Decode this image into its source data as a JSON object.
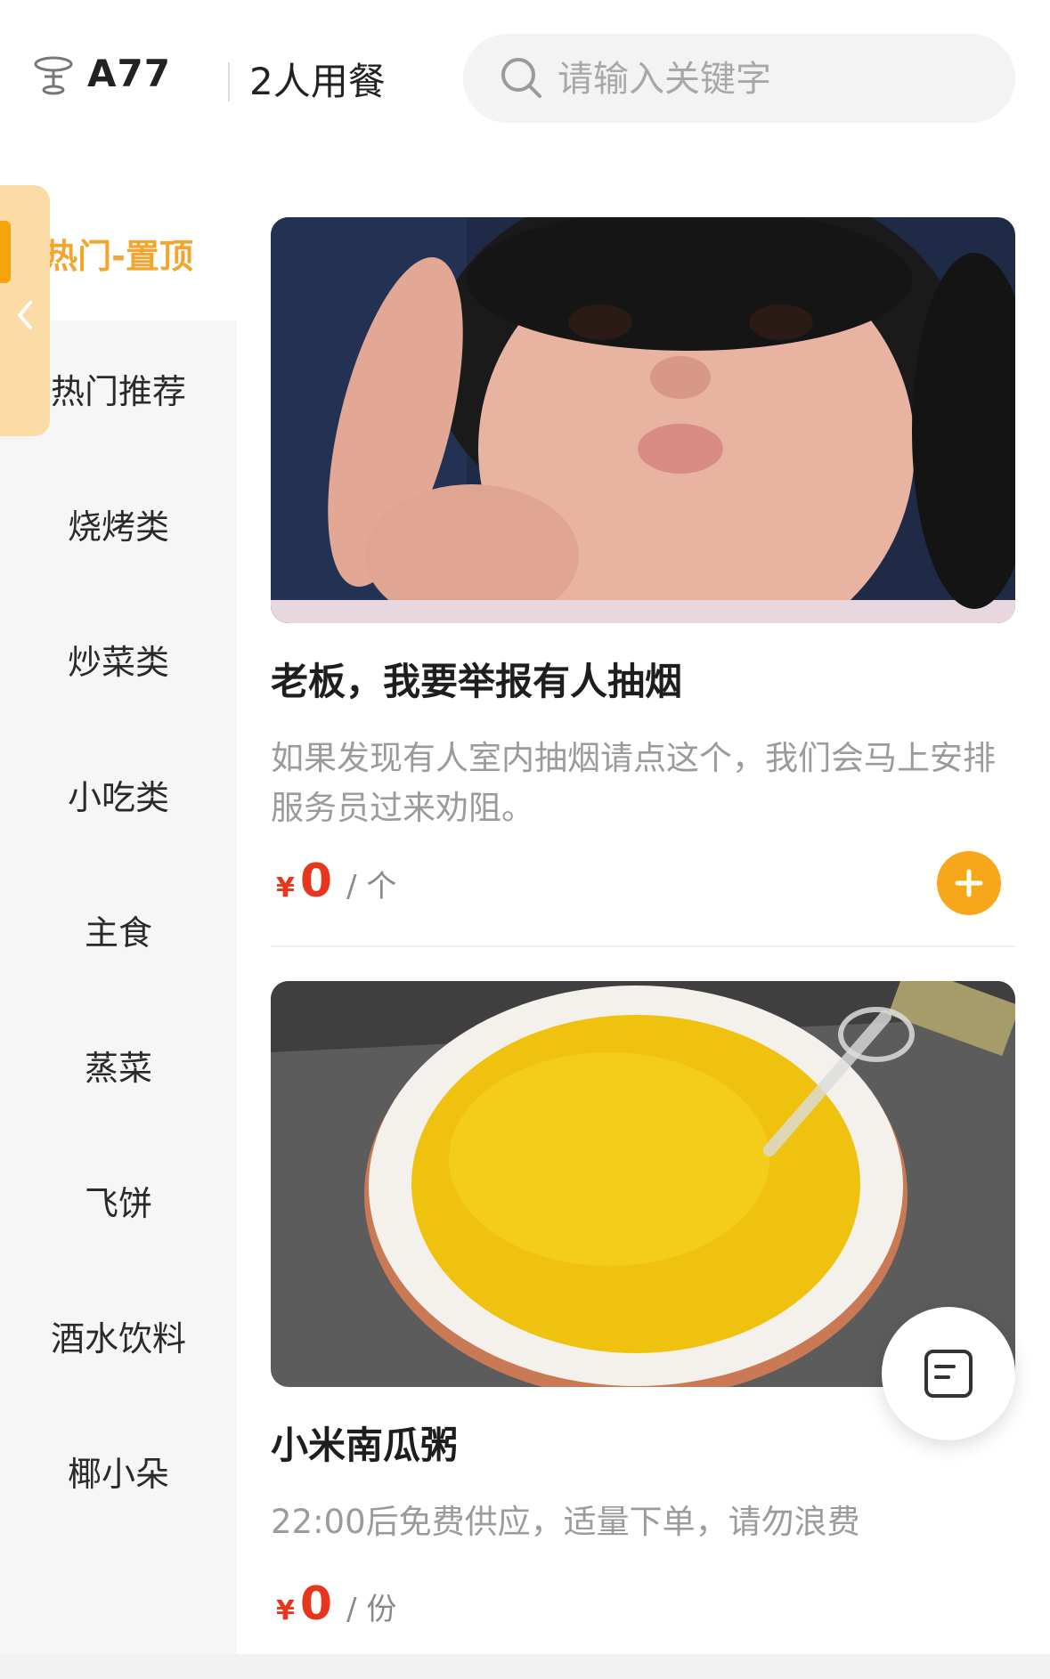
{
  "header": {
    "table_icon": "table-icon",
    "table_no": "A77",
    "diners": "2人用餐",
    "search": {
      "placeholder": "请输入关键字",
      "icon": "search-icon"
    }
  },
  "sidebar": {
    "active_index": 0,
    "items": [
      {
        "label": "热门-置顶"
      },
      {
        "label": "热门推荐"
      },
      {
        "label": "烧烤类"
      },
      {
        "label": "炒菜类"
      },
      {
        "label": "小吃类"
      },
      {
        "label": "主食"
      },
      {
        "label": "蒸菜"
      },
      {
        "label": "飞饼"
      },
      {
        "label": "酒水饮料"
      },
      {
        "label": "椰小朵"
      }
    ],
    "collapse_icon": "chevron-left-icon"
  },
  "products": [
    {
      "image": "child-waving-photo",
      "name": "老板，我要举报有人抽烟",
      "desc": "如果发现有人室内抽烟请点这个，我们会马上安排服务员过来劝阻。",
      "currency": "¥",
      "price": "0",
      "unit": "/ 个",
      "add_icon": "plus-icon"
    },
    {
      "image": "millet-pumpkin-porridge-photo",
      "name": "小米南瓜粥",
      "desc": "22:00后免费供应，适量下单，请勿浪费",
      "currency": "¥",
      "price": "0",
      "unit": "/ 份"
    }
  ],
  "float_button": {
    "icon": "order-list-icon"
  },
  "colors": {
    "accent": "#f7a71a",
    "active_text": "#f0a630",
    "price": "#e8361e",
    "sidebar_bg": "#f6f6f6",
    "tab_bg": "#fcdca6"
  }
}
